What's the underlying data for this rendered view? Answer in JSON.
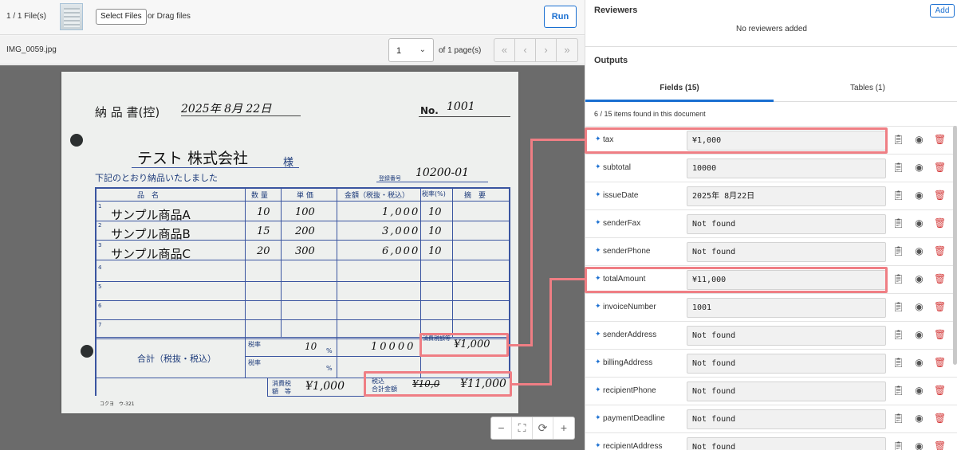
{
  "toolbar": {
    "file_count": "1 / 1 File(s)",
    "select_files": "Select Files",
    "drag_text": "or Drag files",
    "run": "Run"
  },
  "viewer": {
    "filename": "IMG_0059.jpg",
    "page_value": "1",
    "page_of": "of 1 page(s)",
    "pager": [
      "«",
      "‹",
      "›",
      "»"
    ],
    "zoom": [
      "−",
      "⛶",
      "⟳",
      "+"
    ]
  },
  "document": {
    "title": "納 品 書(控)",
    "date": "2025年 8月 22日",
    "no_label": "No.",
    "no_value": "1001",
    "recipient": "テスト 株式会社",
    "sama": "様",
    "note": "下記のとおり納品いたしました",
    "reg_label": "登録番号",
    "reg_value": "10200-01",
    "headers": [
      "品　名",
      "数 量",
      "単 価",
      "金額（税抜・税込）",
      "税率(%)",
      "摘　要"
    ],
    "items": [
      {
        "no": "1",
        "name": "サンプル商品A",
        "qty": "10",
        "price": "100",
        "amount": "1,000",
        "rate": "10"
      },
      {
        "no": "2",
        "name": "サンプル商品B",
        "qty": "15",
        "price": "200",
        "amount": "3,000",
        "rate": "10"
      },
      {
        "no": "3",
        "name": "サンプル商品C",
        "qty": "20",
        "price": "300",
        "amount": "6,000",
        "rate": "10"
      }
    ],
    "empty_rows": [
      "4",
      "5",
      "6",
      "7"
    ],
    "total_label": "合計（税抜・税込）",
    "rate_label": "税率",
    "rate_value": "10",
    "percent": "%",
    "subtotal": "10000",
    "tax_label": "消費税額等",
    "tax_value": "¥1,000",
    "tax_label2a": "消費税",
    "tax_label2b": "額　等",
    "tax_value2": "¥1,000",
    "total_label2a": "税込",
    "total_label2b": "合計金額",
    "total_struck": "¥10,0",
    "total_value": "¥11,000",
    "footer": "コクヨ　ウ-321"
  },
  "reviewers": {
    "title": "Reviewers",
    "add": "Add",
    "empty": "No reviewers added"
  },
  "outputs": {
    "title": "Outputs",
    "tab_fields": "Fields (15)",
    "tab_tables": "Tables (1)",
    "found": "6 / 15 items found in this document",
    "fields": [
      {
        "name": "tax",
        "value": "¥1,000",
        "highlight": true
      },
      {
        "name": "subtotal",
        "value": "10000"
      },
      {
        "name": "issueDate",
        "value": "2025年 8月22日"
      },
      {
        "name": "senderFax",
        "value": "Not found"
      },
      {
        "name": "senderPhone",
        "value": "Not found"
      },
      {
        "name": "totalAmount",
        "value": "¥11,000",
        "highlight": true
      },
      {
        "name": "invoiceNumber",
        "value": "1001"
      },
      {
        "name": "senderAddress",
        "value": "Not found"
      },
      {
        "name": "billingAddress",
        "value": "Not found"
      },
      {
        "name": "recipientPhone",
        "value": "Not found"
      },
      {
        "name": "paymentDeadline",
        "value": "Not found"
      },
      {
        "name": "recipientAddress",
        "value": "Not found"
      }
    ]
  },
  "colors": {
    "accent": "#1a6fd1",
    "highlight": "#ef7e84",
    "delete": "#d43c3c"
  },
  "icons": [
    "copy-icon",
    "eye-icon",
    "trash-icon",
    "star-icon"
  ]
}
